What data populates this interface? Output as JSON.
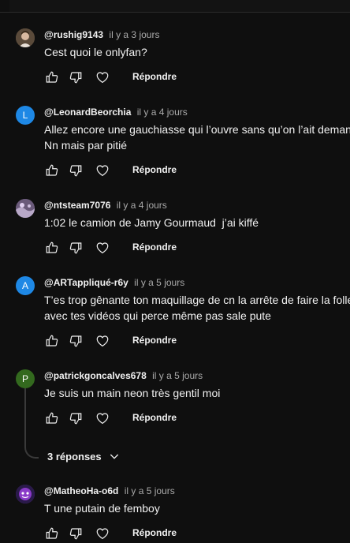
{
  "actions": {
    "like_icon": "thumbs-up-icon",
    "dislike_icon": "thumbs-down-icon",
    "heart_icon": "heart-icon",
    "reply_label": "Répondre"
  },
  "comments": [
    {
      "author": "@rushig9143",
      "time": "il y a 3 jours",
      "text": "Cest quoi le onlyfan?",
      "avatar_type": "photo",
      "avatar_color": "#8a7a6a"
    },
    {
      "author": "@LeonardBeorchia",
      "time": "il y a 4 jours",
      "text": "Allez encore une gauchiasse qui l’ouvre sans qu’on l’ait demandé\nNn mais par pitié",
      "avatar_type": "letter",
      "avatar_letter": "L",
      "avatar_color": "#1e88e5"
    },
    {
      "author": "@ntsteam7076",
      "time": "il y a 4 jours",
      "text": "1:02 le camion de Jamy Gourmaud  j’ai kiffé",
      "avatar_type": "photo",
      "avatar_color": "#7a6a8a"
    },
    {
      "author": "@ARTappliqué-r6y",
      "time": "il y a 5 jours",
      "text": "T’es trop gênante ton maquillage de cn la arrête de faire la folle\navec tes vidéos qui perce même pas sale pute",
      "avatar_type": "letter",
      "avatar_letter": "A",
      "avatar_color": "#1e88e5"
    },
    {
      "author": "@patrickgoncalves678",
      "time": "il y a 5 jours",
      "text": "Je suis un main neon très gentil moi",
      "avatar_type": "letter",
      "avatar_letter": "P",
      "avatar_color": "#33691e"
    },
    {
      "author": "@MatheoHa-o6d",
      "time": "il y a 5 jours",
      "text": "T une putain de femboy",
      "avatar_type": "photo",
      "avatar_color": "#5a2a8a"
    }
  ],
  "replies_toggle": {
    "label": "3 réponses",
    "icon": "chevron-down-icon"
  }
}
